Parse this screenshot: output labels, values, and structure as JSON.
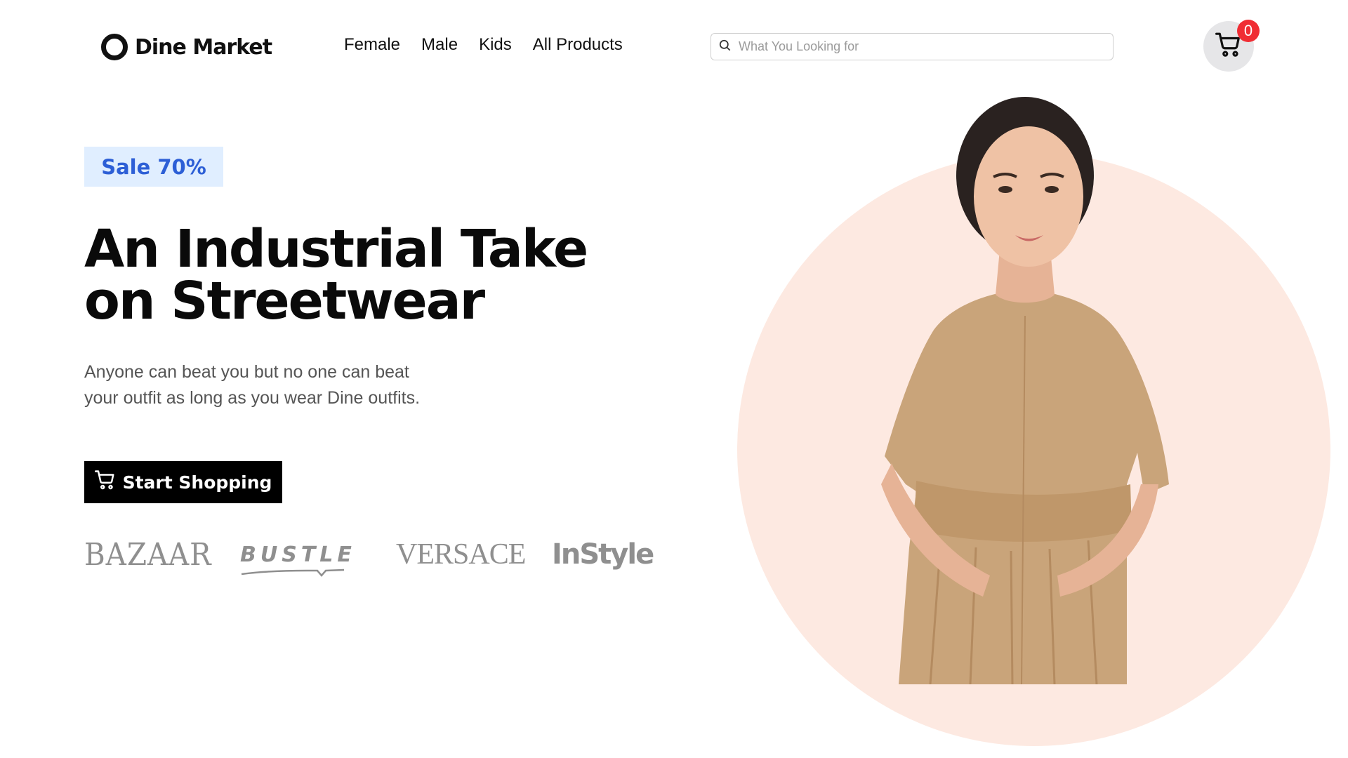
{
  "header": {
    "logo_text": "Dine Market",
    "nav": [
      "Female",
      "Male",
      "Kids",
      "All Products"
    ],
    "search_placeholder": "What You Looking for",
    "cart_count": "0"
  },
  "hero": {
    "badge": "Sale 70%",
    "headline_line1": "An Industrial Take",
    "headline_line2": "on Streetwear",
    "subtext_line1": "Anyone can beat you but no one can beat",
    "subtext_line2": "your outfit as long as you wear Dine outfits.",
    "cta_label": "Start Shopping",
    "brands": [
      "BAZAAR",
      "BUSTLE",
      "VERSACE",
      "InStyle"
    ]
  },
  "colors": {
    "accent_badge_bg": "#e0eeff",
    "accent_badge_text": "#2d5fd6",
    "circle_bg": "#fde9e1",
    "cart_badge": "#f02d34"
  }
}
